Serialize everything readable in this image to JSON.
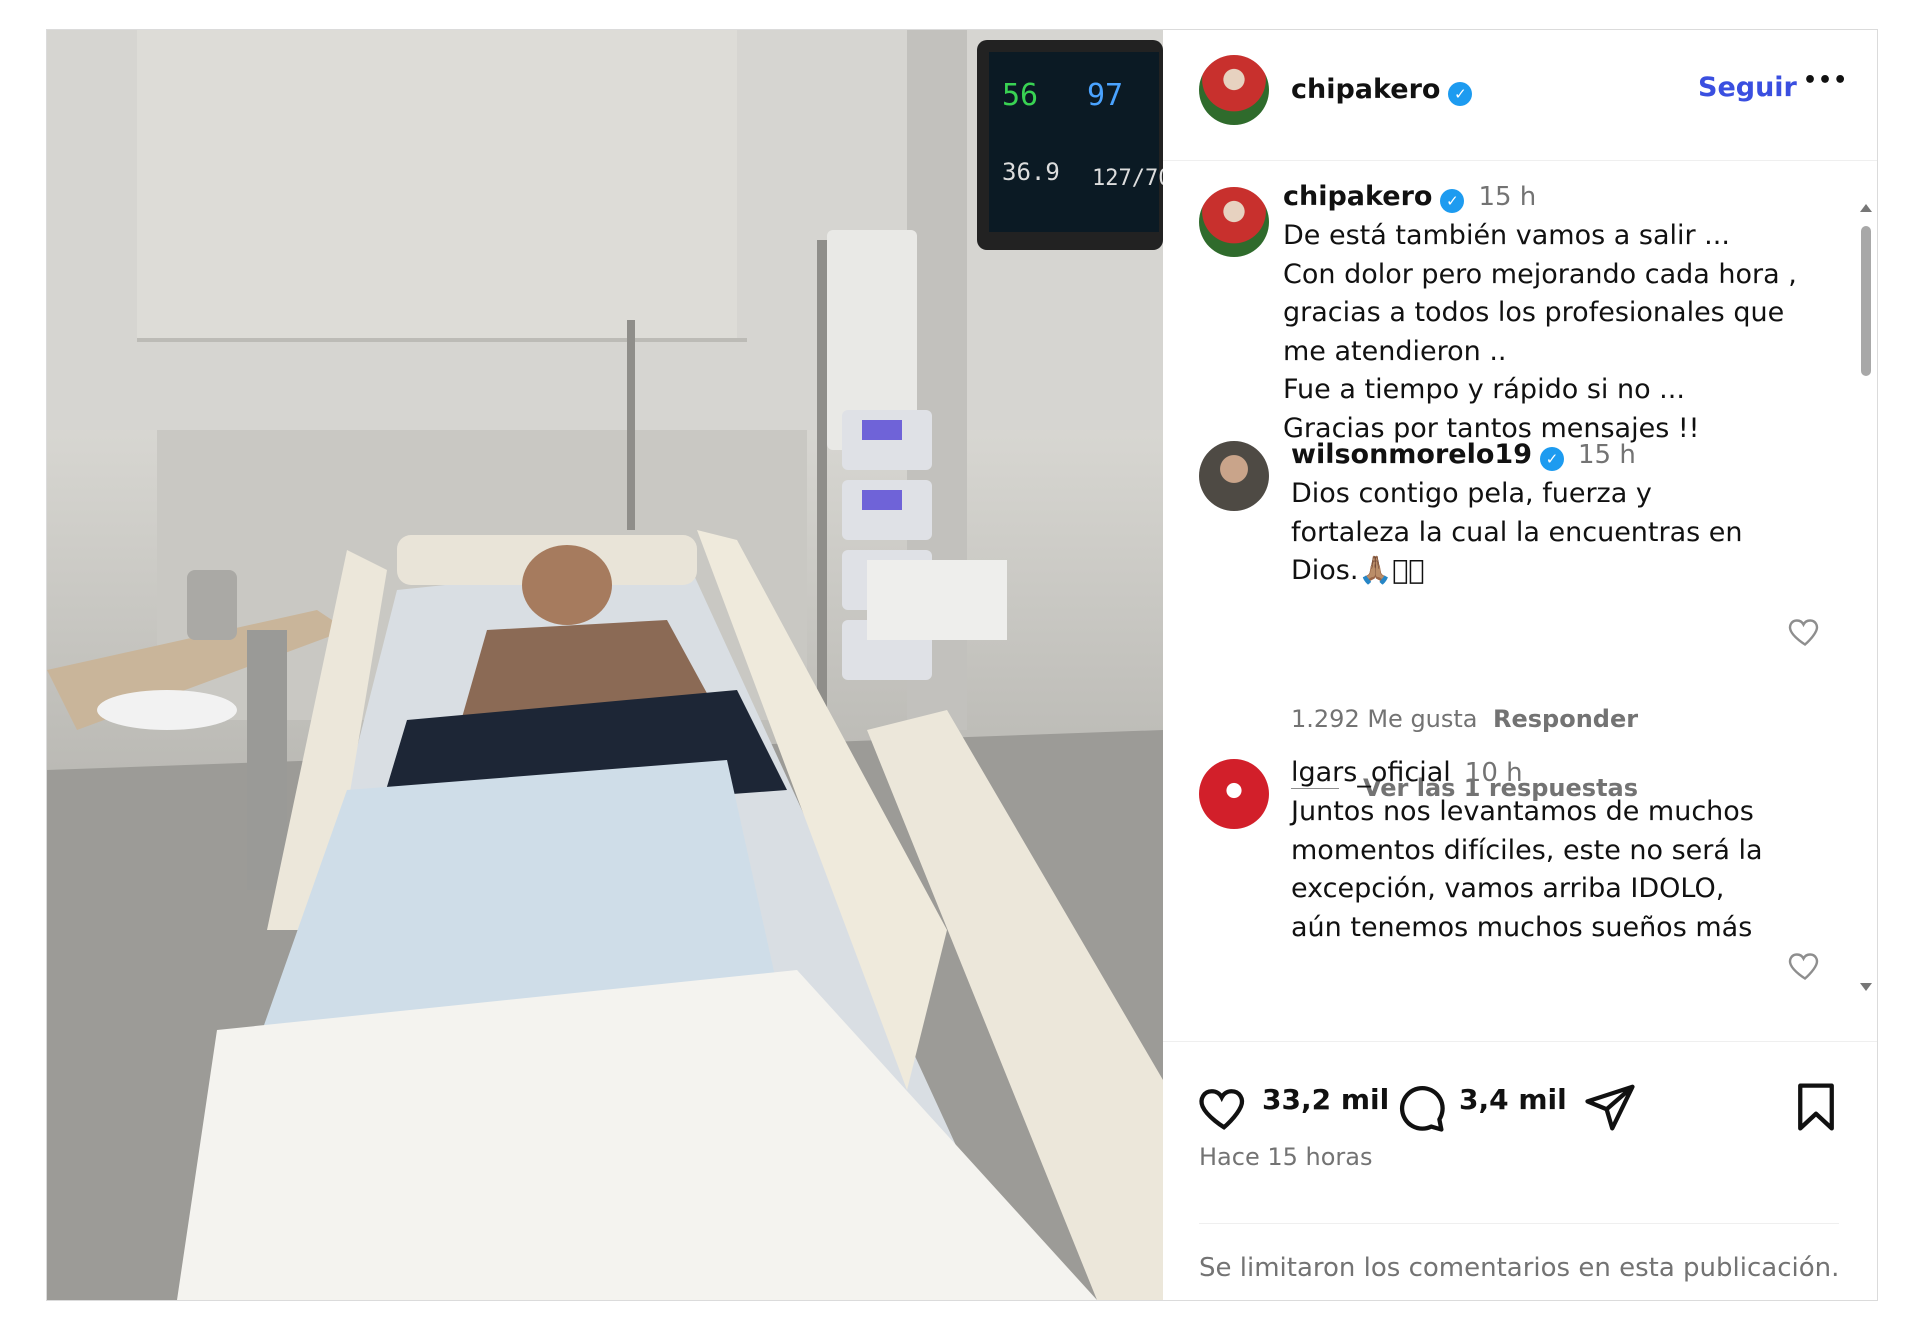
{
  "post": {
    "author": "chipakero",
    "follow_label": "Seguir",
    "more_label": "•••",
    "caption": {
      "username": "chipakero",
      "time": "15 h",
      "text": "De está también vamos a salir ...\nCon dolor pero mejorando cada hora ,\ngracias a todos los profesionales que\nme atendieron ..\nFue a tiempo y rápido si no ...\nGracias por tantos mensajes !!"
    },
    "comments": [
      {
        "username": "wilsonmorelo19",
        "time": "15 h",
        "text": "Dios contigo pela, fuerza y\nfortaleza la cual la encuentras en\nDios.🙏🏽􀀀􀀀",
        "likes": "1.292 Me gusta",
        "reply_label": "Responder",
        "view_replies": "Ver las 1 respuestas"
      },
      {
        "username": "lgars_oficial",
        "time": "10 h",
        "text": "Juntos nos levantamos de muchos\nmomentos difíciles, este no será la\nexcepción, vamos arriba IDOLO,\naún tenemos muchos sueños más"
      }
    ],
    "likes_count": "33,2 mil",
    "comments_count": "3,4 mil",
    "posted_ago": "Hace 15 horas",
    "comments_limited": "Se limitaron los comentarios en esta publicación."
  },
  "colors": {
    "link": "#0095f6",
    "verified": "#1d9bf0",
    "muted": "#737373"
  },
  "icons": [
    "heart-icon",
    "comment-icon",
    "share-icon",
    "bookmark-icon",
    "more-icon",
    "verified-icon"
  ]
}
